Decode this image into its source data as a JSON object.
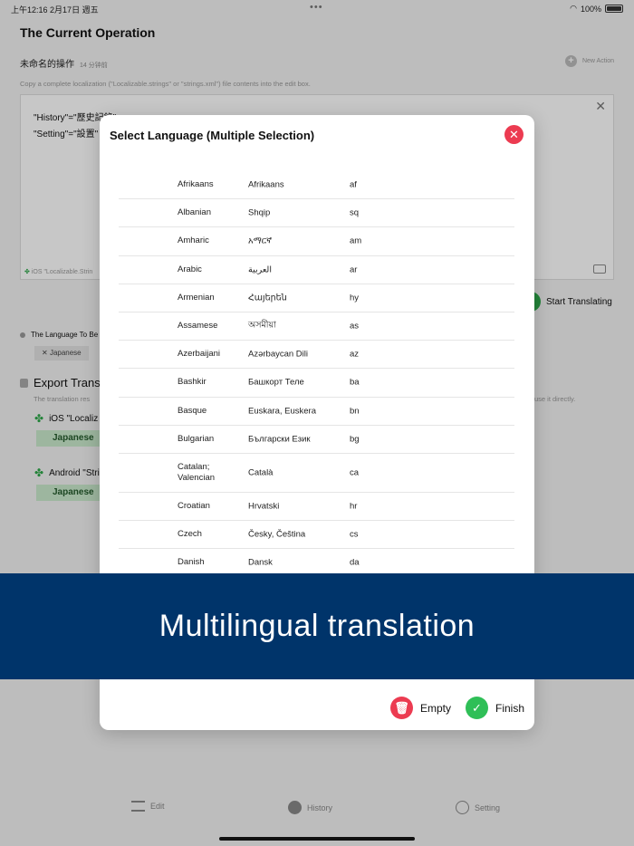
{
  "status_bar": {
    "time": "上午12:16",
    "date": "2月17日 週五",
    "battery": "100%"
  },
  "background": {
    "page_title": "The Current Operation",
    "action_name": "未命名的操作",
    "action_time": "14 分钟前",
    "new_action": "New Action",
    "hint": "Copy a complete localization (\"Localizable.strings\" or \"strings.xml\") file contents into the edit box.",
    "editor_lines": [
      "\"History\"=\"歷史記錄\";",
      "\"Setting\"=\"設置\""
    ],
    "editor_format": "iOS \"Localizable.Strin",
    "start_button": "Start Translating",
    "language_to_label": "The Language To Be",
    "language_chip": "Japanese",
    "export_title": "Export Trans",
    "export_hint": "The translation res",
    "export_hint_right": "use it directly.",
    "export_items": [
      {
        "label": "iOS \"Localiz",
        "chip": "Japanese"
      },
      {
        "label": "Android \"Stri",
        "chip": "Japanese"
      }
    ]
  },
  "tabs": [
    {
      "label": "Edit",
      "icon": "edit-icon"
    },
    {
      "label": "History",
      "icon": "history-icon"
    },
    {
      "label": "Setting",
      "icon": "setting-icon"
    }
  ],
  "modal": {
    "title": "Select Language (Multiple Selection)",
    "languages": [
      {
        "english": "Afrikaans",
        "native": "Afrikaans",
        "code": "af"
      },
      {
        "english": "Albanian",
        "native": "Shqip",
        "code": "sq"
      },
      {
        "english": "Amharic",
        "native": "አማርኛ",
        "code": "am"
      },
      {
        "english": "Arabic",
        "native": "العربية",
        "code": "ar"
      },
      {
        "english": "Armenian",
        "native": "Հայերեն",
        "code": "hy"
      },
      {
        "english": "Assamese",
        "native": "অসমীয়া",
        "code": "as"
      },
      {
        "english": "Azerbaijani",
        "native": "Azərbaycan Dili",
        "code": "az"
      },
      {
        "english": "Bashkir",
        "native": "Башкорт Теле",
        "code": "ba"
      },
      {
        "english": "Basque",
        "native": "Euskara, Euskera",
        "code": "bn"
      },
      {
        "english": "Bulgarian",
        "native": "Български Език",
        "code": "bg"
      },
      {
        "english": "Catalan; Valencian",
        "native": "Català",
        "code": "ca"
      },
      {
        "english": "Croatian",
        "native": "Hrvatski",
        "code": "hr"
      },
      {
        "english": "Czech",
        "native": "Česky, Čeština",
        "code": "cs"
      },
      {
        "english": "Danish",
        "native": "Dansk",
        "code": "da"
      }
    ],
    "empty_label": "Empty",
    "finish_label": "Finish"
  },
  "banner": {
    "text": "Multilingual translation"
  },
  "colors": {
    "banner": "#00346a",
    "accent_red": "#ec3b51",
    "accent_green": "#2fbf57"
  }
}
